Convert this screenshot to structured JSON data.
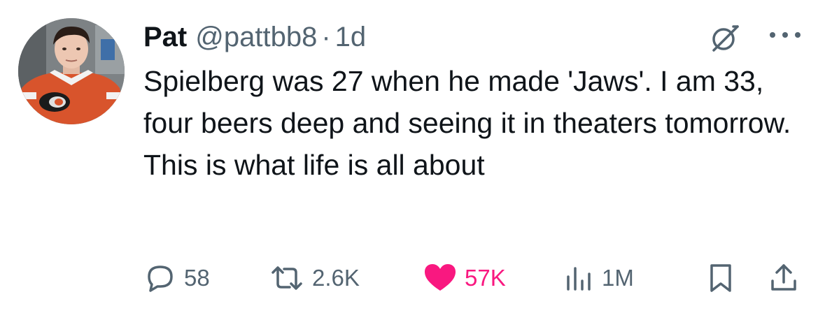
{
  "author": {
    "name": "Pat",
    "handle": "@pattbb8",
    "separator": "·",
    "time": "1d"
  },
  "tweet": {
    "text": "Spielberg was 27 when he made 'Jaws'. I am 33, four beers deep and seeing it in theaters tomorrow. This is what life is all about"
  },
  "actions": {
    "replies": "58",
    "retweets": "2.6K",
    "likes": "57K",
    "views": "1M"
  },
  "icons": {
    "avatar": "avatar-photo",
    "grok": "grok-icon",
    "more": "more-icon",
    "reply": "reply-icon",
    "retweet": "retweet-icon",
    "like": "heart-icon",
    "views": "views-icon",
    "bookmark": "bookmark-icon",
    "share": "share-icon"
  },
  "colors": {
    "text": "#0f1419",
    "secondary": "#536471",
    "like": "#f91880",
    "background": "#ffffff"
  }
}
